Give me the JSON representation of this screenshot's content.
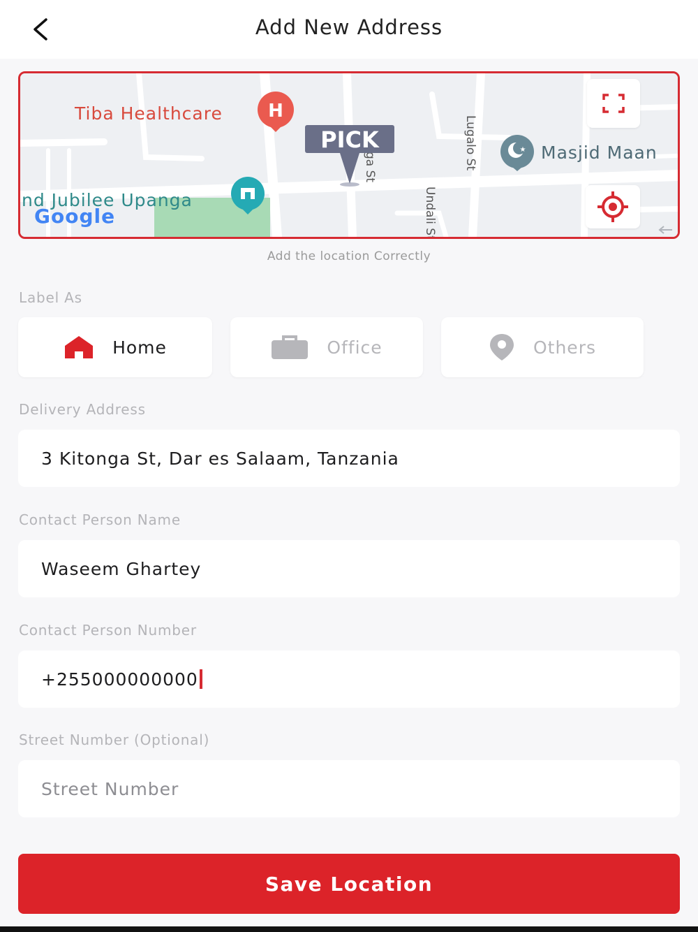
{
  "header": {
    "title": "Add New Address"
  },
  "map": {
    "hint": "Add the location Correctly",
    "pick_label": "PICK",
    "places": {
      "healthcare": "Tiba Healthcare",
      "masjid": "Masjid Maan",
      "jubilee": "nd Jubilee Upanga",
      "google": "Google"
    },
    "streets": {
      "lugalo": "Lugalo St",
      "undali": "Undali St",
      "kitonga": "ga St"
    }
  },
  "label_as": {
    "title": "Label As",
    "options": [
      {
        "label": "Home",
        "icon": "home-icon",
        "selected": true
      },
      {
        "label": "Office",
        "icon": "briefcase-icon",
        "selected": false
      },
      {
        "label": "Others",
        "icon": "location-pin-icon",
        "selected": false
      }
    ]
  },
  "form": {
    "delivery_address": {
      "label": "Delivery Address",
      "value": "3 Kitonga St, Dar es Salaam, Tanzania"
    },
    "contact_name": {
      "label": "Contact Person Name",
      "value": "Waseem Ghartey"
    },
    "contact_number": {
      "label": "Contact Person Number",
      "value": "+255000000000"
    },
    "street_number": {
      "label": "Street Number (Optional)",
      "placeholder": "Street Number"
    }
  },
  "save_button": {
    "label": "Save Location"
  },
  "colors": {
    "accent": "#dc2329",
    "background": "#f7f7f9",
    "inactive": "#b6b6ba"
  }
}
